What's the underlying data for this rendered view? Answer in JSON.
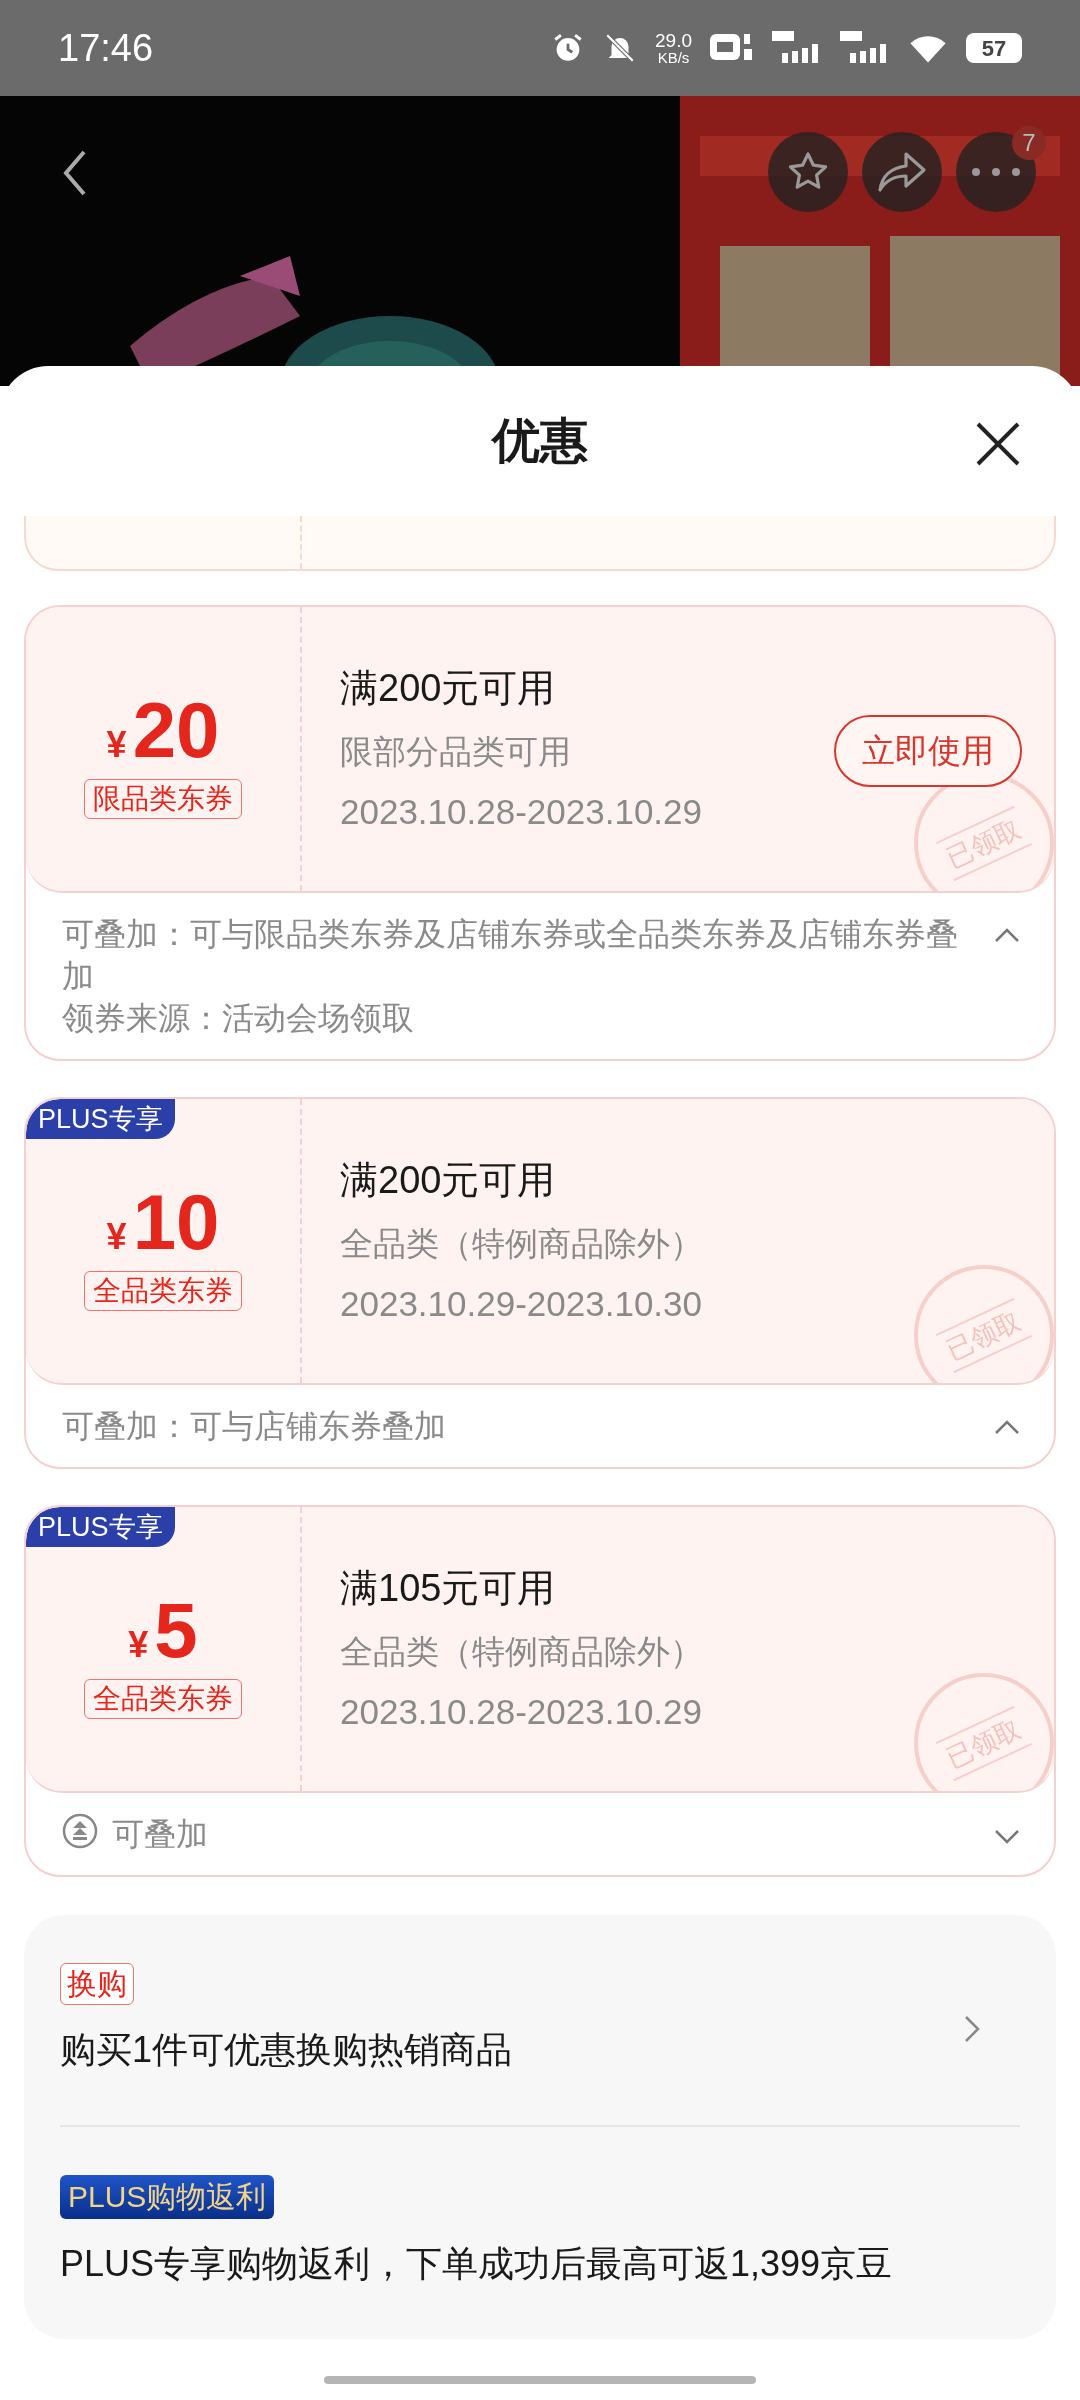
{
  "status_bar": {
    "time": "17:46",
    "net_speed": "29.0",
    "net_unit": "KB/s",
    "battery": "57"
  },
  "top_bar": {
    "more_badge": "7"
  },
  "sheet": {
    "title": "优惠"
  },
  "coupons": [
    {
      "currency": "¥",
      "amount": "20",
      "tag": "限品类东券",
      "condition": "满200元可用",
      "scope": "限部分品类可用",
      "dates": "2023.10.28-2023.10.29",
      "action": "立即使用",
      "stamp": "已领取",
      "expanded": true,
      "details": [
        "可叠加：可与限品类东券及店铺东券或全品类东券及店铺东券叠加",
        "领券来源：活动会场领取"
      ]
    },
    {
      "plus_badge": "PLUS专享",
      "currency": "¥",
      "amount": "10",
      "tag": "全品类东券",
      "condition": "满200元可用",
      "scope": "全品类（特例商品除外）",
      "dates": "2023.10.29-2023.10.30",
      "stamp": "已领取",
      "expanded": true,
      "details": [
        "可叠加：可与店铺东券叠加"
      ]
    },
    {
      "plus_badge": "PLUS专享",
      "currency": "¥",
      "amount": "5",
      "tag": "全品类东券",
      "condition": "满105元可用",
      "scope": "全品类（特例商品除外）",
      "dates": "2023.10.28-2023.10.29",
      "stamp": "已领取",
      "expanded": false,
      "summary": "可叠加"
    }
  ],
  "promos": [
    {
      "kind": "exchange",
      "tag": "换购",
      "text": "购买1件可优惠换购热销商品",
      "has_arrow": true
    },
    {
      "kind": "plus",
      "tag": "PLUS购物返利",
      "text": "PLUS专享购物返利，下单成功后最高可返1,399京豆",
      "has_arrow": false
    }
  ]
}
